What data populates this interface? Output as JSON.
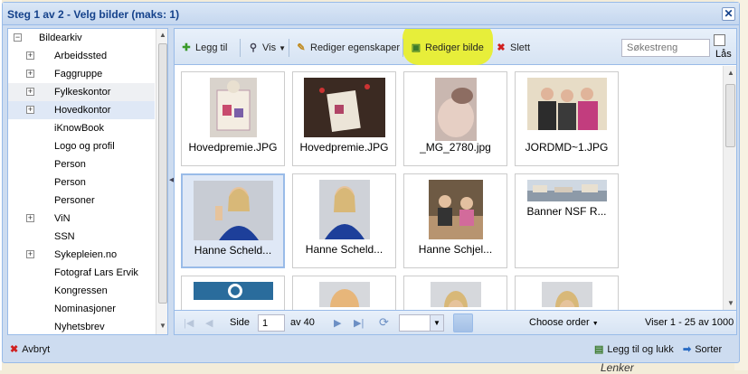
{
  "dialog": {
    "title": "Steg 1 av 2 - Velg bilder (maks: 1)",
    "close_glyph": "✕"
  },
  "tree": {
    "root": {
      "label": "Bildearkiv",
      "expander": "−"
    },
    "items": [
      {
        "label": "Arbeidssted",
        "expander": "+"
      },
      {
        "label": "Faggruppe",
        "expander": "+"
      },
      {
        "label": "Fylkeskontor",
        "expander": "+"
      },
      {
        "label": "Hovedkontor",
        "expander": "+"
      },
      {
        "label": "iKnowBook",
        "expander": ""
      },
      {
        "label": "Logo og profil",
        "expander": ""
      },
      {
        "label": "Person",
        "expander": ""
      },
      {
        "label": "Person",
        "expander": ""
      },
      {
        "label": "Personer",
        "expander": ""
      },
      {
        "label": "ViN",
        "expander": "+"
      },
      {
        "label": "SSN",
        "expander": ""
      },
      {
        "label": "Sykepleien.no",
        "expander": "+"
      },
      {
        "label": "Fotograf Lars Ervik",
        "expander": ""
      },
      {
        "label": "Kongressen",
        "expander": ""
      },
      {
        "label": "Nominasjoner",
        "expander": ""
      },
      {
        "label": "Nyhetsbrev",
        "expander": ""
      }
    ]
  },
  "toolbar": {
    "add_label": "Legg til",
    "view_label": "Vis",
    "edit_props_label": "Rediger egenskaper",
    "edit_image_label": "Rediger bilde",
    "delete_label": "Slett",
    "search_placeholder": "Søkestreng",
    "lock_label": "Lås",
    "highlight_color": "#e7ee3a"
  },
  "images": [
    {
      "caption": "Hovedpremie.JPG"
    },
    {
      "caption": "Hovedpremie.JPG"
    },
    {
      "caption": "_MG_2780.jpg"
    },
    {
      "caption": "JORDMD~1.JPG"
    },
    {
      "caption": "Hanne Scheld...",
      "selected": true
    },
    {
      "caption": "Hanne Scheld..."
    },
    {
      "caption": "Hanne Schjel..."
    },
    {
      "caption": "Banner NSF R..."
    },
    {
      "caption": ""
    },
    {
      "caption": ""
    },
    {
      "caption": ""
    },
    {
      "caption": ""
    }
  ],
  "pager": {
    "page_label": "Side",
    "page_value": "1",
    "of_label": "av 40",
    "order_label": "Choose order",
    "summary": "Viser 1 - 25 av 1000"
  },
  "footer": {
    "cancel_label": "Avbryt",
    "add_close_label": "Legg til og lukk",
    "sort_label": "Sorter"
  },
  "background": {
    "link_text": "Lenker"
  }
}
